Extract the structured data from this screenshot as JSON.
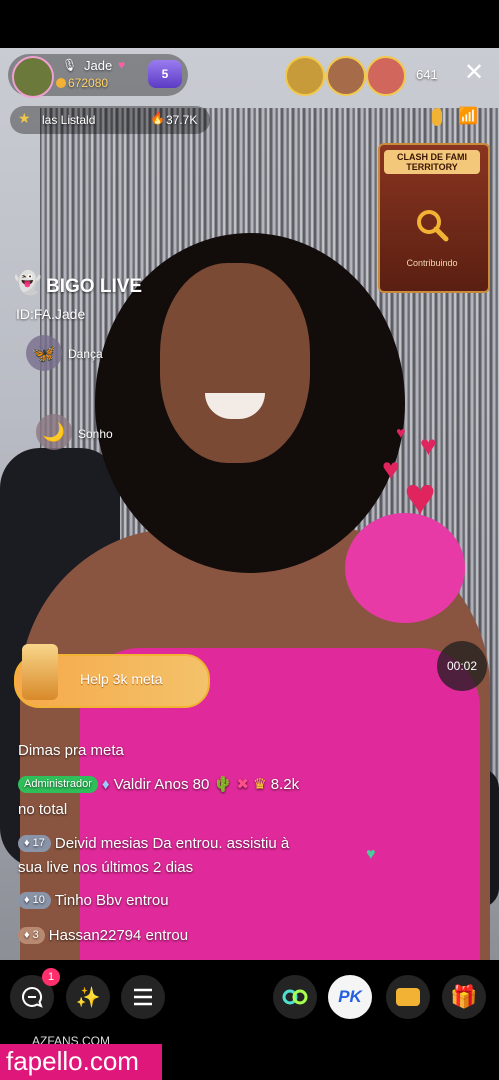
{
  "host": {
    "name": "Jade",
    "beans": "672080",
    "level": "5"
  },
  "viewers": {
    "count": "641"
  },
  "ranking": {
    "label": "las  Listald",
    "hot": "37.7K"
  },
  "event_banner": {
    "title": "CLASH DE FAMI TERRITORY",
    "button": "Contribuindo"
  },
  "watermark": {
    "brand": "BIGO LIVE",
    "id": "ID:FA.Jade"
  },
  "side_items": [
    {
      "label": "Dança"
    },
    {
      "label": "Sonho"
    }
  ],
  "goal_banner": {
    "text": "Help 3k meta"
  },
  "timer": "00:02",
  "chat": {
    "line1": "Dimas pra meta",
    "admin_badge": "Administrador",
    "line2_user": "Valdir Anos 80",
    "line2_amount": "8.2k",
    "line3": "no total",
    "line4_level": "17",
    "line4_text": "Deivid mesias Da entrou. assistiu à",
    "line5": "sua live nos últimos 2 dias",
    "line6_level": "10",
    "line6_text": "Tinho Bbv entrou",
    "line7_level": "3",
    "line7_text": "Hassan22794 entrou"
  },
  "bottom": {
    "chat_badge": "1",
    "pk_label": "PK"
  },
  "footer": {
    "site1": "AZFANS.COM",
    "site2": "fapello.com"
  },
  "colors": {
    "pink": "#e0299a",
    "gold": "#f2b233",
    "admin_green": "#2fbf5a",
    "event_brown": "#6a2415"
  }
}
